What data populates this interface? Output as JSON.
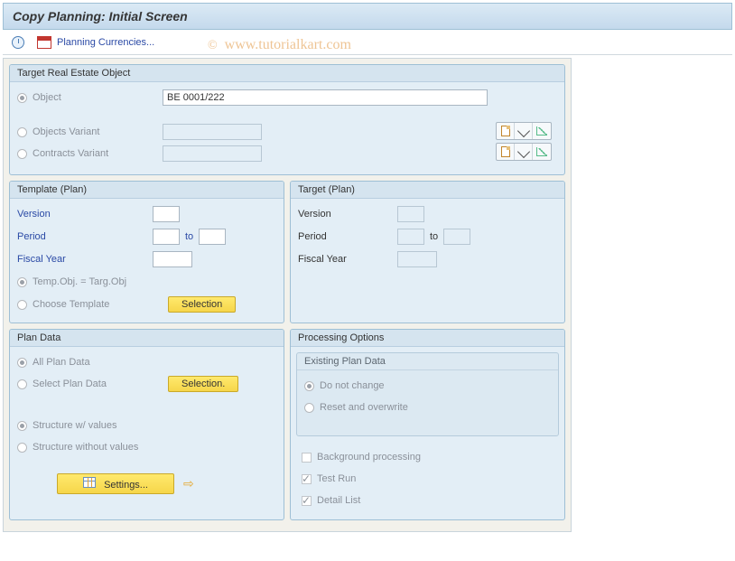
{
  "title": "Copy Planning: Initial Screen",
  "toolbar": {
    "planning_currencies": "Planning Currencies..."
  },
  "watermark": {
    "copy": "©",
    "text": "www.tutorialkart.com"
  },
  "target_object": {
    "title": "Target Real Estate Object",
    "object_label": "Object",
    "object_value": "BE 0001/222",
    "objects_variant_label": "Objects Variant",
    "contracts_variant_label": "Contracts Variant"
  },
  "template_plan": {
    "title": "Template (Plan)",
    "version_label": "Version",
    "period_label": "Period",
    "to": "to",
    "fiscal_year_label": "Fiscal Year",
    "temp_eq_targ": "Temp.Obj. = Targ.Obj",
    "choose_template": "Choose Template",
    "selection_btn": "Selection"
  },
  "target_plan": {
    "title": "Target (Plan)",
    "version_label": "Version",
    "period_label": "Period",
    "to": "to",
    "fiscal_year_label": "Fiscal Year"
  },
  "plan_data": {
    "title": "Plan Data",
    "all": "All Plan Data",
    "select": "Select Plan Data",
    "selection_btn": "Selection.",
    "struct_vals": "Structure w/ values",
    "struct_novals": "Structure without values",
    "settings_btn": "Settings..."
  },
  "processing": {
    "title": "Processing Options",
    "existing_title": "Existing Plan Data",
    "do_not_change": "Do not change",
    "reset_overwrite": "Reset and overwrite",
    "background": "Background processing",
    "test_run": "Test Run",
    "detail_list": "Detail List"
  }
}
